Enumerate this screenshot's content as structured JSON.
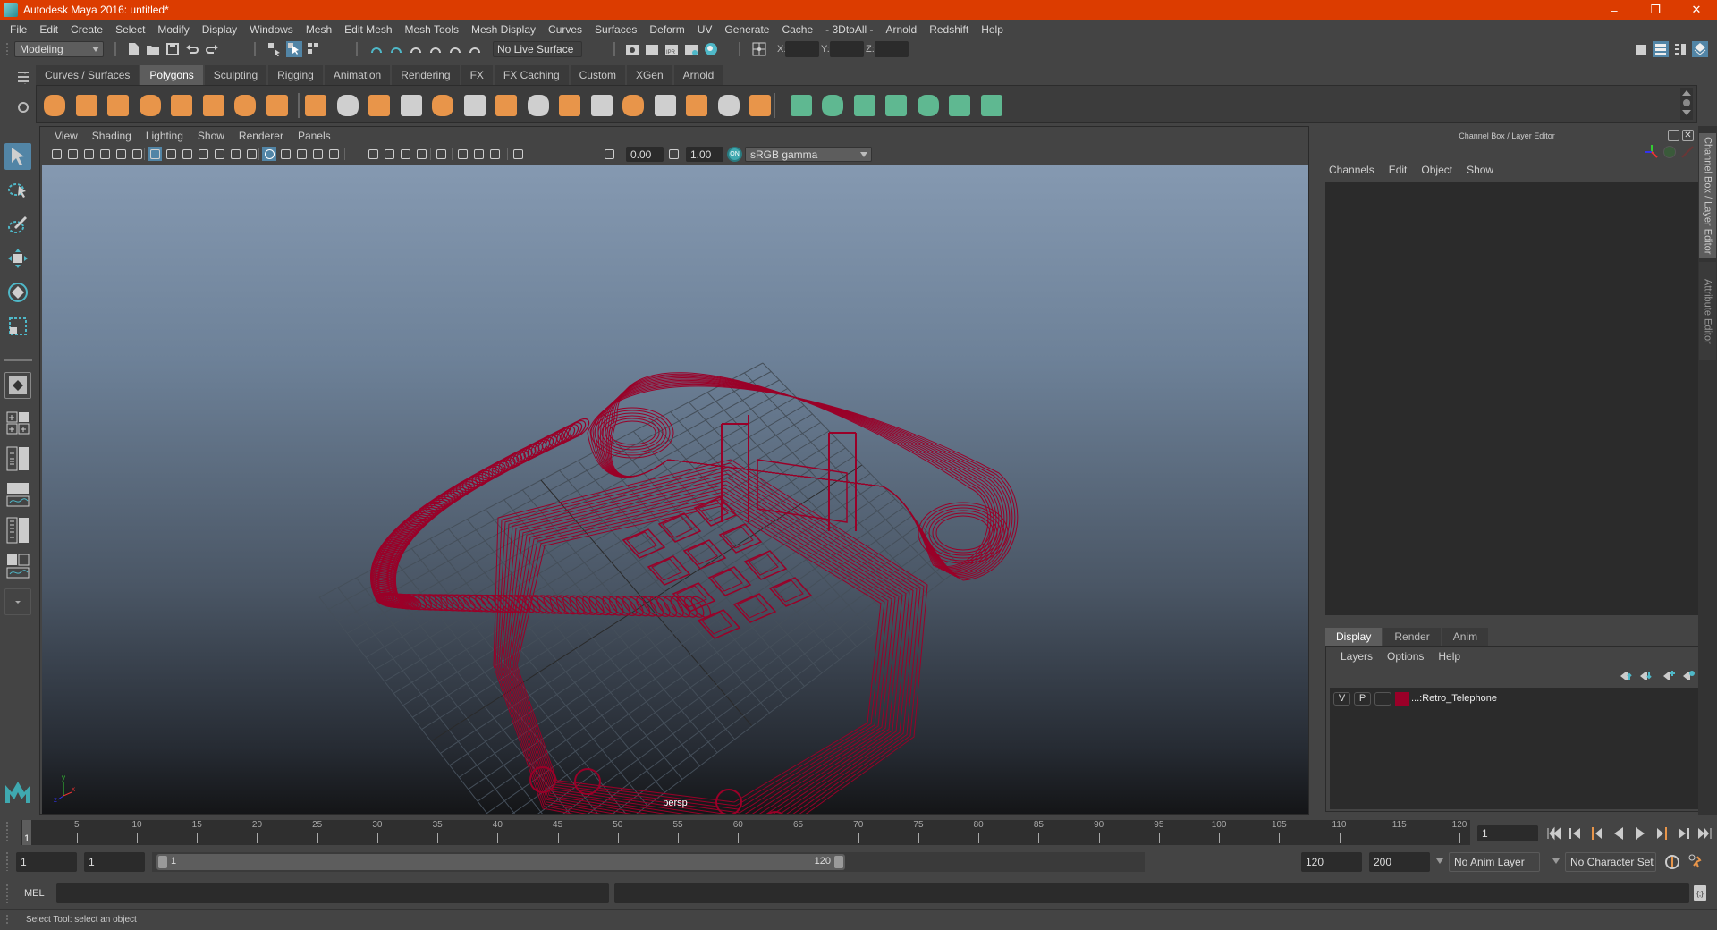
{
  "window": {
    "title": "Autodesk Maya 2016: untitled*",
    "buttons": [
      "–",
      "❐",
      "✕"
    ]
  },
  "menubar": [
    "File",
    "Edit",
    "Create",
    "Select",
    "Modify",
    "Display",
    "Windows",
    "Mesh",
    "Edit Mesh",
    "Mesh Tools",
    "Mesh Display",
    "Curves",
    "Surfaces",
    "Deform",
    "UV",
    "Generate",
    "Cache",
    "- 3DtoAll -",
    "Arnold",
    "Redshift",
    "Help"
  ],
  "statusline": {
    "menuset": "Modeling",
    "live_surface": "No Live Surface",
    "x_label": "X:",
    "y_label": "Y:",
    "z_label": "Z:",
    "x_value": "",
    "y_value": "",
    "z_value": ""
  },
  "shelf": {
    "tabs": [
      "Curves / Surfaces",
      "Polygons",
      "Sculpting",
      "Rigging",
      "Animation",
      "Rendering",
      "FX",
      "FX Caching",
      "Custom",
      "XGen",
      "Arnold"
    ],
    "active_tab": "Polygons",
    "icons": [
      "poly-sphere-icon",
      "poly-cube-icon",
      "poly-cylinder-icon",
      "poly-cone-icon",
      "poly-plane-icon",
      "poly-torus-icon",
      "poly-pyramid-icon",
      "poly-pipe-icon",
      "combine-icon",
      "separate-icon",
      "mirror-icon",
      "smooth-icon",
      "bevel-icon",
      "bridge-icon",
      "extrude-icon",
      "multi-cut-icon",
      "target-weld-icon",
      "merge-icon",
      "fill-hole-icon",
      "insert-edge-loop-icon",
      "offset-edge-loop-icon",
      "append-polygon-icon",
      "collapse-icon",
      "planar-mapping-icon",
      "cylindrical-mapping-icon",
      "spherical-mapping-icon",
      "automatic-mapping-icon",
      "unfold-icon",
      "uv-editor-icon",
      "layout-uvs-icon"
    ]
  },
  "viewport": {
    "menu": [
      "View",
      "Shading",
      "Lighting",
      "Show",
      "Renderer",
      "Panels"
    ],
    "exposure": "0.00",
    "gamma": "1.00",
    "color_space": "sRGB gamma",
    "camera_label": "persp",
    "axis_labels": {
      "x": "x",
      "y": "y",
      "z": "z"
    }
  },
  "channel_box": {
    "title": "Channel Box / Layer Editor",
    "menu": [
      "Channels",
      "Edit",
      "Object",
      "Show"
    ]
  },
  "layer_editor": {
    "tabs": [
      "Display",
      "Render",
      "Anim"
    ],
    "active_tab": "Display",
    "menu": [
      "Layers",
      "Options",
      "Help"
    ],
    "layers": [
      {
        "visible": "V",
        "playback": "P",
        "color": "#9a0028",
        "name": "...:Retro_Telephone"
      }
    ]
  },
  "side_tabs": [
    "Channel Box / Layer Editor",
    "Attribute Editor"
  ],
  "timeline": {
    "ticks": [
      5,
      10,
      15,
      20,
      25,
      30,
      35,
      40,
      45,
      50,
      55,
      60,
      65,
      70,
      75,
      80,
      85,
      90,
      95,
      100,
      105,
      110,
      115,
      120
    ],
    "start": 1,
    "end": 120,
    "current_frame": "1",
    "current_frame_field": "1"
  },
  "range": {
    "start_time": "1",
    "playback_start": "1",
    "range_start_label": "1",
    "range_end_label": "120",
    "playback_end": "120",
    "end_time": "200",
    "anim_layer": "No Anim Layer",
    "character_set": "No Character Set"
  },
  "command_line": {
    "label": "MEL",
    "value": "",
    "result": ""
  },
  "help_line": "Select Tool: select an object",
  "colors": {
    "titlebar": "#dc3c00",
    "wireframe": "#9a0028",
    "accent": "#5285a6",
    "shelf_orange": "#e8954a",
    "shelf_green": "#5fb891"
  }
}
